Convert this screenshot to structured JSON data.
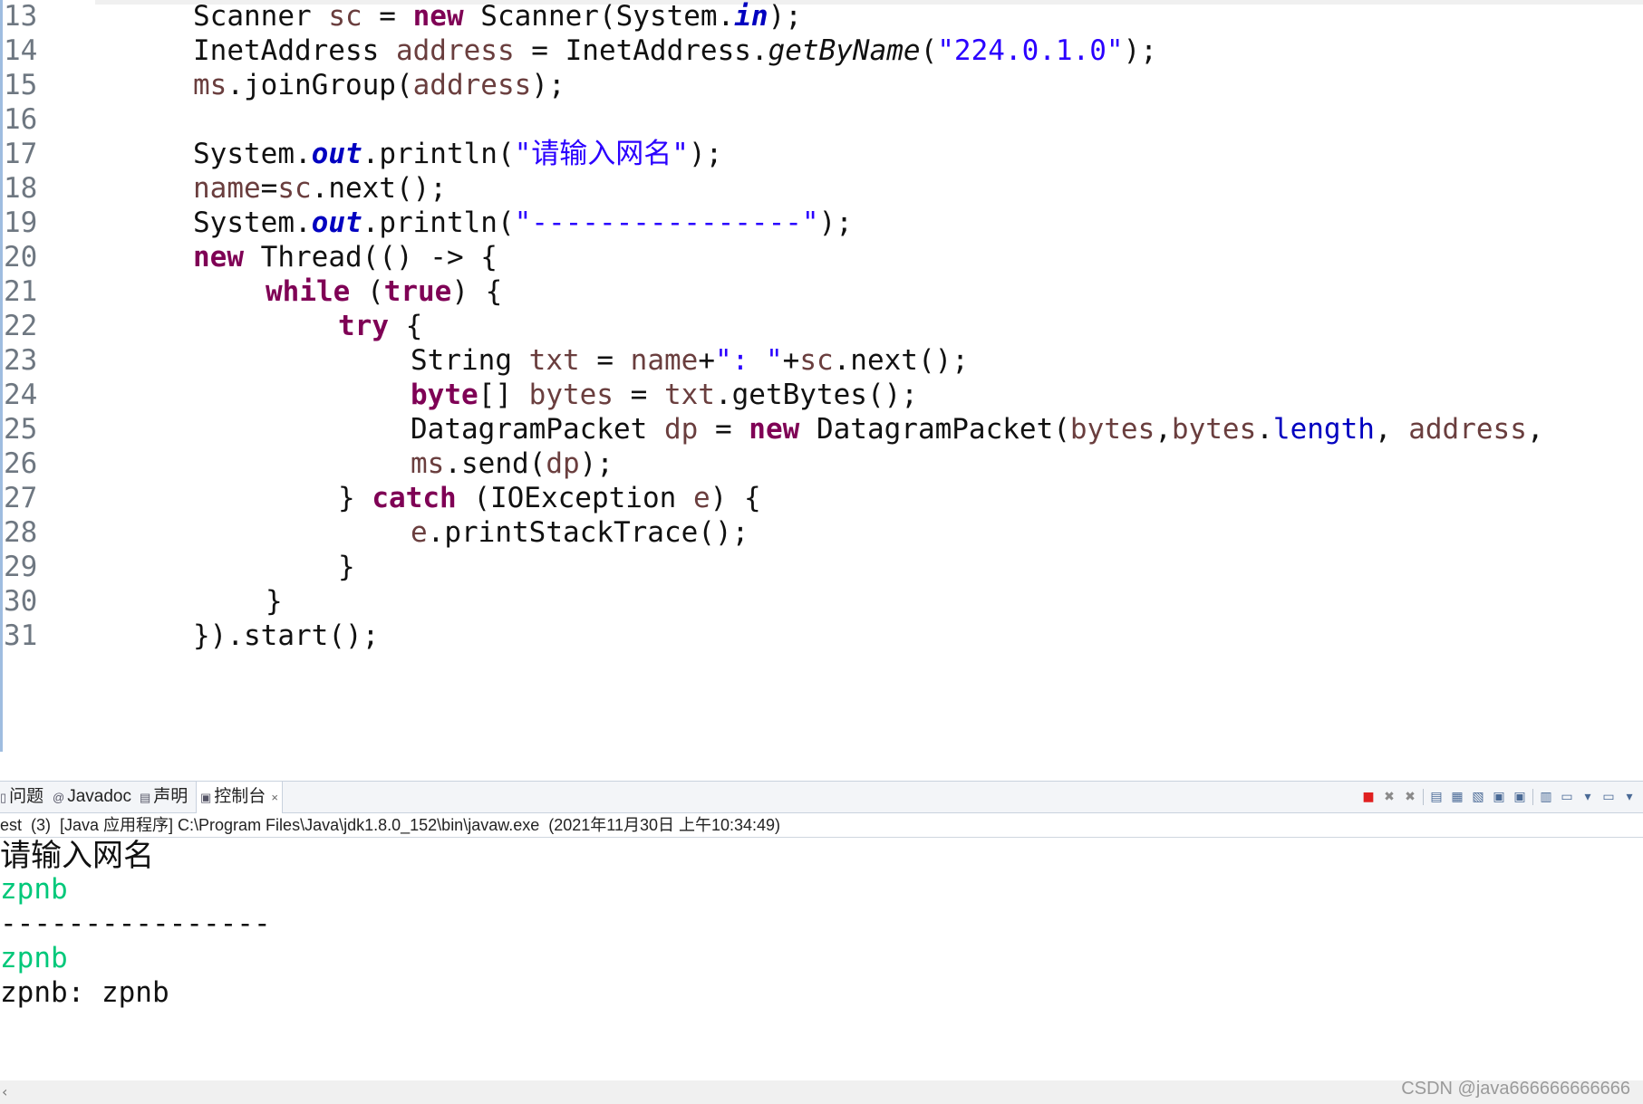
{
  "editor": {
    "line_numbers": [
      "13",
      "14",
      "15",
      "16",
      "17",
      "18",
      "19",
      "20",
      "21",
      "22",
      "23",
      "24",
      "25",
      "26",
      "27",
      "28",
      "29",
      "30",
      "31"
    ],
    "lines": [
      "Scanner sc = new Scanner(System.in);",
      "InetAddress address = InetAddress.getByName(\"224.0.1.0\");",
      "ms.joinGroup(address);",
      "",
      "System.out.println(\"请输入网名\");",
      "name=sc.next();",
      "System.out.println(\"----------------\");",
      "new Thread(() -> {",
      "while (true) {",
      "try {",
      "String txt = name+\": \"+sc.next();",
      "byte[] bytes = txt.getBytes();",
      "DatagramPacket dp = new DatagramPacket(bytes,bytes.length, address,",
      "ms.send(dp);",
      "} catch (IOException e) {",
      "e.printStackTrace();",
      "}",
      "}",
      "}).start();"
    ]
  },
  "console_view": {
    "tabs": [
      {
        "label": "问题"
      },
      {
        "label": "Javadoc"
      },
      {
        "label": "声明"
      },
      {
        "label": "控制台",
        "close": "×"
      }
    ],
    "info": "est  (3)  [Java 应用程序] C:\\Program Files\\Java\\jdk1.8.0_152\\bin\\javaw.exe  (2021年11月30日 上午10:34:49)",
    "output": [
      "请输入网名",
      "zpnb",
      "----------------",
      "zpnb",
      "zpnb: zpnb"
    ]
  },
  "colors": {
    "keyword": "#7f0055",
    "field": "#0000c0",
    "string": "#2a00ff",
    "variable": "#6a3e3e",
    "console_input": "#00c87a"
  },
  "watermark": "CSDN @java666666666666"
}
